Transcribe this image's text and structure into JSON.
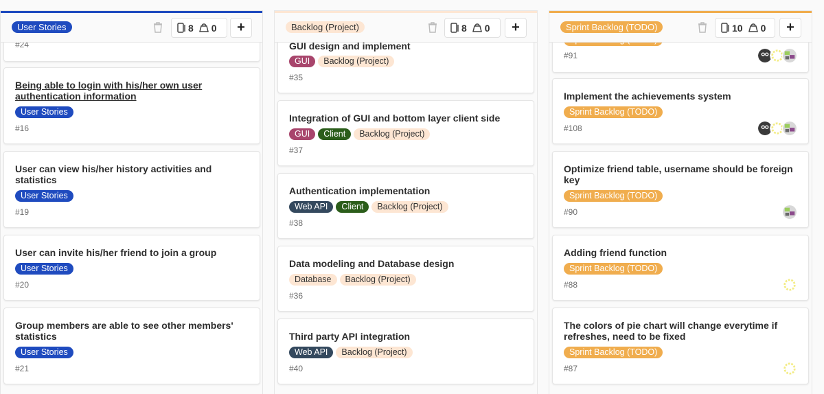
{
  "colors": {
    "user_stories": "#1f4bbf",
    "backlog": "#fde6d3",
    "sprint": "#f0ad4e",
    "gui": "#a8456c",
    "client": "#2b5d1a",
    "web_api": "#34495e",
    "database": "#fde6d3"
  },
  "lists": [
    {
      "label": "User Stories",
      "issues_count": "8",
      "weight_count": "0",
      "cards": [
        {
          "title": "",
          "labels": [],
          "number": "#24"
        },
        {
          "title": "Being able to login with his/her own user authentication information",
          "labels": [
            "User Stories"
          ],
          "number": "#16"
        },
        {
          "title": "User can view his/her history activities and statistics",
          "labels": [
            "User Stories"
          ],
          "number": "#19"
        },
        {
          "title": "User can invite his/her friend to join a group",
          "labels": [
            "User Stories"
          ],
          "number": "#20"
        },
        {
          "title": "Group members are able to see other members' statistics",
          "labels": [
            "User Stories"
          ],
          "number": "#21"
        }
      ]
    },
    {
      "label": "Backlog (Project)",
      "issues_count": "8",
      "weight_count": "0",
      "cards": [
        {
          "title": "GUI design and implement",
          "labels": [
            "GUI",
            "Backlog (Project)"
          ],
          "number": "#35"
        },
        {
          "title": "Integration of GUI and bottom layer client side",
          "labels": [
            "GUI",
            "Client",
            "Backlog (Project)"
          ],
          "number": "#37"
        },
        {
          "title": "Authentication implementation",
          "labels": [
            "Web API",
            "Client",
            "Backlog (Project)"
          ],
          "number": "#38"
        },
        {
          "title": "Data modeling and Database design",
          "labels": [
            "Database",
            "Backlog (Project)"
          ],
          "number": "#36"
        },
        {
          "title": "Third party API integration",
          "labels": [
            "Web API",
            "Backlog (Project)"
          ],
          "number": "#40"
        }
      ]
    },
    {
      "label": "Sprint Backlog (TODO)",
      "issues_count": "10",
      "weight_count": "0",
      "cards": [
        {
          "title": "",
          "labels": [
            "Sprint Backlog (TODO)"
          ],
          "number": "#91"
        },
        {
          "title": "Implement the achievements system",
          "labels": [
            "Sprint Backlog (TODO)"
          ],
          "number": "#108"
        },
        {
          "title": "Optimize friend table, username should be foreign key",
          "labels": [
            "Sprint Backlog (TODO)"
          ],
          "number": "#90"
        },
        {
          "title": "Adding friend function",
          "labels": [
            "Sprint Backlog (TODO)"
          ],
          "number": "#88"
        },
        {
          "title": "The colors of pie chart will change everytime if refreshes, need to be fixed",
          "labels": [
            "Sprint Backlog (TODO)"
          ],
          "number": "#87"
        }
      ]
    }
  ]
}
